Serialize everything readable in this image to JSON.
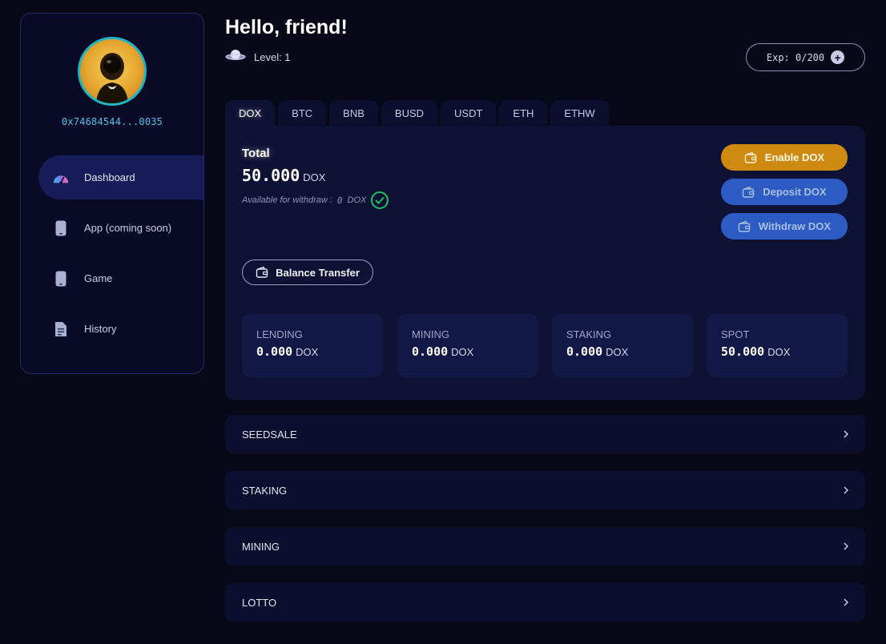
{
  "sidebar": {
    "wallet_address": "0x74684544...0035",
    "nav": [
      {
        "label": "Dashboard",
        "icon": "speedometer-icon",
        "active": true
      },
      {
        "label": "App (coming soon)",
        "icon": "phone-icon",
        "active": false
      },
      {
        "label": "Game",
        "icon": "phone-icon",
        "active": false
      },
      {
        "label": "History",
        "icon": "document-icon",
        "active": false
      }
    ]
  },
  "header": {
    "greeting": "Hello, friend!",
    "level": "Level: 1",
    "exp": "Exp: 0/200"
  },
  "tabs": [
    {
      "label": "DOX",
      "active": true
    },
    {
      "label": "BTC",
      "active": false
    },
    {
      "label": "BNB",
      "active": false
    },
    {
      "label": "BUSD",
      "active": false
    },
    {
      "label": "USDT",
      "active": false
    },
    {
      "label": "ETH",
      "active": false
    },
    {
      "label": "ETHW",
      "active": false
    }
  ],
  "balance": {
    "total_label": "Total",
    "total_value": "50.000",
    "unit": "DOX",
    "available_label": "Available for withdraw :",
    "available_value": "0",
    "available_unit": "DOX"
  },
  "actions": {
    "enable": "Enable DOX",
    "deposit": "Deposit DOX",
    "withdraw": "Withdraw DOX",
    "transfer": "Balance Transfer"
  },
  "stats": [
    {
      "label": "LENDING",
      "value": "0.000",
      "unit": "DOX"
    },
    {
      "label": "MINING",
      "value": "0.000",
      "unit": "DOX"
    },
    {
      "label": "STAKING",
      "value": "0.000",
      "unit": "DOX"
    },
    {
      "label": "SPOT",
      "value": "50.000",
      "unit": "DOX"
    }
  ],
  "sections": [
    {
      "label": "SEEDSALE"
    },
    {
      "label": "STAKING"
    },
    {
      "label": "MINING"
    },
    {
      "label": "LOTTO"
    }
  ],
  "colors": {
    "background": "#070818",
    "panel": "#0d1133",
    "accent_gold": "#ce8a10",
    "accent_blue": "#2c5cc3",
    "address_cyan": "#4ec1e7",
    "success_green": "#1fbf62"
  }
}
